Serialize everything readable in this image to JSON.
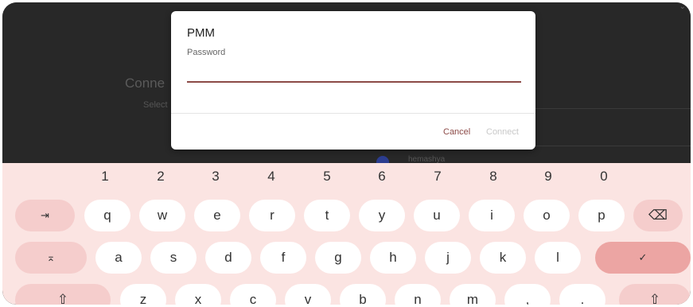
{
  "background": {
    "title": "Conne",
    "subtitle": "Select",
    "peek_text": "hemashya"
  },
  "dialog": {
    "title": "PMM",
    "password_label": "Password",
    "password_value": "",
    "cancel_label": "Cancel",
    "connect_label": "Connect"
  },
  "keyboard": {
    "numbers": [
      "1",
      "2",
      "3",
      "4",
      "5",
      "6",
      "7",
      "8",
      "9",
      "0"
    ],
    "row1": [
      "q",
      "w",
      "e",
      "r",
      "t",
      "y",
      "u",
      "i",
      "o",
      "p"
    ],
    "row2": [
      "a",
      "s",
      "d",
      "f",
      "g",
      "h",
      "j",
      "k",
      "l"
    ],
    "row3": [
      "z",
      "x",
      "c",
      "v",
      "b",
      "n",
      "m",
      ",",
      "."
    ],
    "tab_glyph": "⇥",
    "backspace_glyph": "⌫",
    "caps_glyph": "⌅",
    "enter_glyph": "✓",
    "shift_glyph": "⇧"
  },
  "colors": {
    "accent": "#8c4a47",
    "keyboard_bg": "#fbe4e2",
    "fn_key": "#f5cdcc",
    "enter_key": "#eca5a3"
  }
}
